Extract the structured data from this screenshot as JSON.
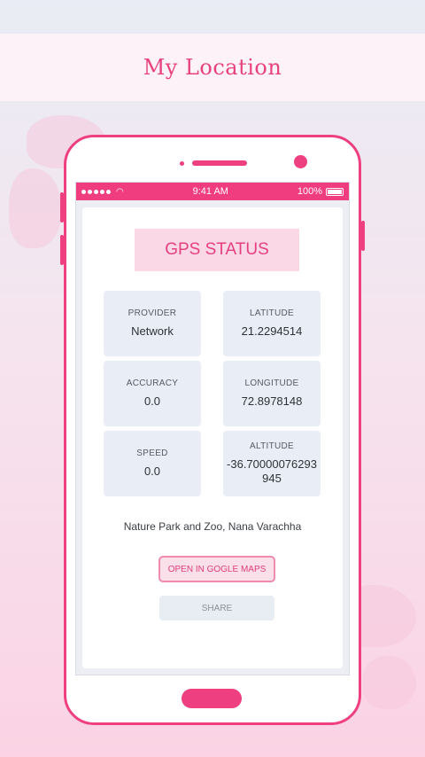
{
  "header": {
    "title": "My Location"
  },
  "status_bar": {
    "time": "9:41 AM",
    "battery": "100%"
  },
  "gps": {
    "title": "GPS STATUS",
    "tiles": [
      {
        "label": "PROVIDER",
        "value": "Network"
      },
      {
        "label": "LATITUDE",
        "value": "21.2294514"
      },
      {
        "label": "ACCURACY",
        "value": "0.0"
      },
      {
        "label": "LONGITUDE",
        "value": "72.8978148"
      },
      {
        "label": "SPEED",
        "value": "0.0"
      },
      {
        "label": "ALTITUDE",
        "value": "-36.70000076293945"
      }
    ],
    "address": "Nature Park and Zoo, Nana Varachha",
    "open_maps_label": "OPEN IN GOGLE MAPS",
    "share_label": "SHARE"
  },
  "colors": {
    "accent": "#ee3f81",
    "title": "#e8427e",
    "tile_bg": "#e9edf5"
  }
}
